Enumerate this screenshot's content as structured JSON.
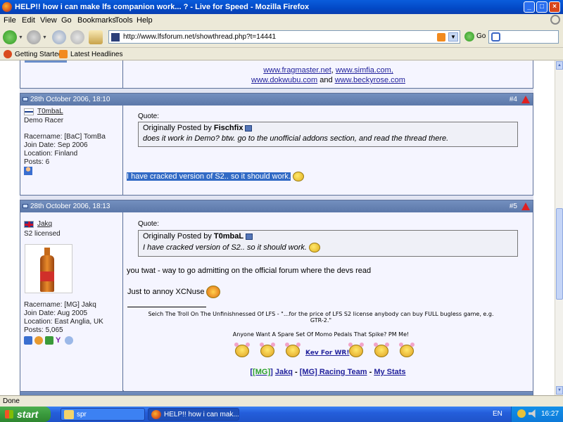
{
  "window": {
    "title": "HELP!! how i can make lfs companion work... ? - Live for Speed - Mozilla Firefox"
  },
  "menu": [
    "File",
    "Edit",
    "View",
    "Go",
    "Bookmarks",
    "Tools",
    "Help"
  ],
  "toolbar": {
    "url": "http://www.lfsforum.net/showthread.php?t=14441",
    "go_label": "Go"
  },
  "bookmarks": [
    "Getting Started",
    "Latest Headlines"
  ],
  "prev_sig": {
    "line1": [
      "www.fragmaster.net",
      "www.simfia.com,"
    ],
    "line2": [
      "www.dokwubu.com",
      "and",
      "www.beckyrose.com"
    ]
  },
  "posts": [
    {
      "date": "28th October 2006, 18:10",
      "num": "#4",
      "user": "T0mbaL",
      "rank": "Demo Racer",
      "racername": "Racername: [BaC] TomBa",
      "join": "Join Date: Sep 2006",
      "location": "Location: Finland",
      "posts": "Posts: 6",
      "quote_label": "Quote:",
      "quote_by_prefix": "Originally Posted by",
      "quote_author": "Fischfix",
      "quote_text": "does it work in Demo? btw. go to the unofficial addons section, and read the thread there.",
      "message": "I have cracked version of S2.. so it should work."
    },
    {
      "date": "28th October 2006, 18:13",
      "num": "#5",
      "user": "Jakq",
      "rank": "S2 licensed",
      "racername": "Racername: [MG] Jakq",
      "join": "Join Date: Aug 2005",
      "location": "Location: East Anglia, UK",
      "posts": "Posts: 5,065",
      "quote_label": "Quote:",
      "quote_by_prefix": "Originally Posted by",
      "quote_author": "T0mbaL",
      "quote_text": "I have cracked version of S2.. so it should work.",
      "message1": "you twat - way to go admitting on the official forum where the devs read",
      "message2": "Just to annoy XCNuse",
      "sig1": "Seich The Troll On The Unfinishnessed Of LFS - \"...for the price of LFS S2 license anybody can buy FULL bugless game, e.g.",
      "sig1b": "GTR-2.\"",
      "sig2": "Anyone Want A Spare Set Of Momo Pedals That Spike? PM Me!",
      "sig_link": "Kev For WR!",
      "sig3_team": "[MG]",
      "sig3_name": "Jakq",
      "sig3_dash1": "-",
      "sig3_racing": "[MG] Racing Team",
      "sig3_dash2": "-",
      "sig3_stats": "My Stats"
    }
  ],
  "statusbar": {
    "text": "Done"
  },
  "taskbar": {
    "start": "start",
    "tasks": [
      "spr",
      "HELP!! how i can mak..."
    ],
    "lang": "EN",
    "clock": "16:27"
  },
  "colors": {
    "title_blue": "#0248c5",
    "post_header": "#5c78a9",
    "link": "#22229c",
    "selection": "#316ac5"
  }
}
